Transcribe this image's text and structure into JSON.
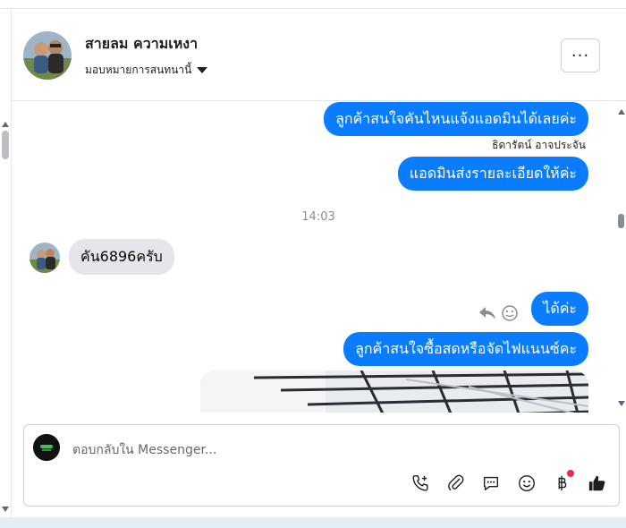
{
  "header": {
    "name": "สายลม ความเหงา",
    "assign_label": "มอบหมายการสนทนานี้",
    "more_label": "···"
  },
  "messages": {
    "out_1": "ลูกค้าสนใจคันไหนแจ้งแอดมินได้เลยค่ะ",
    "sender_1": "ธิดารัตน์ อาจประจัน",
    "out_2": "แอดมินส่งรายละเอียดให้ค่ะ",
    "timestamp": "14:03",
    "in_1": "คัน6896ครับ",
    "out_3": "ได้ค่ะ",
    "out_4": "ลูกค้าสนใจซื้อสดหรือจัดไฟแนนซ์คะ"
  },
  "composer": {
    "placeholder": "ตอบกลับใน Messenger..."
  },
  "icons": {
    "call": "phone-plus-icon",
    "attach": "paperclip-icon",
    "saved_replies": "chat-bubble-icon",
    "emoji": "smiley-icon",
    "payment": "baht-icon",
    "like": "thumbs-up-icon"
  },
  "colors": {
    "bubble_out": "#0a7cff",
    "bubble_in": "#e4e6eb",
    "notification_dot": "#f02849"
  }
}
